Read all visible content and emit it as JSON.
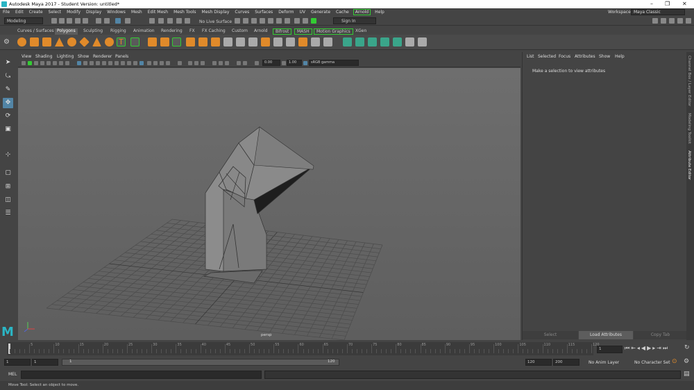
{
  "window": {
    "title": "Autodesk Maya 2017 - Student Version: untitled*",
    "minimize": "–",
    "maximize": "❐",
    "close": "✕"
  },
  "menu": [
    "File",
    "Edit",
    "Create",
    "Select",
    "Modify",
    "Display",
    "Windows",
    "Mesh",
    "Edit Mesh",
    "Mesh Tools",
    "Mesh Display",
    "Curves",
    "Surfaces",
    "Deform",
    "UV",
    "Generate",
    "Cache",
    "Arnold",
    "Help"
  ],
  "workspace": {
    "label": "Workspace :",
    "value": "Maya Classic"
  },
  "status": {
    "mode": "Modeling",
    "live_surface": "No Live Surface",
    "sign_in": "Sign In"
  },
  "shelf_tabs": [
    "Curves / Surfaces",
    "Polygons",
    "Sculpting",
    "Rigging",
    "Animation",
    "Rendering",
    "FX",
    "FX Caching",
    "Custom",
    "Arnold",
    "Bifrost",
    "MASH",
    "Motion Graphics",
    "XGen"
  ],
  "active_shelf": "Polygons",
  "viewport": {
    "menu": [
      "View",
      "Shading",
      "Lighting",
      "Show",
      "Renderer",
      "Panels"
    ],
    "exposure": "0.00",
    "gamma": "1.00",
    "color_space": "sRGB gamma",
    "camera_label": "persp"
  },
  "attribute_editor": {
    "menu": [
      "List",
      "Selected",
      "Focus",
      "Attributes",
      "Show",
      "Help"
    ],
    "message": "Make a selection to view attributes",
    "buttons": [
      "Select",
      "Load Attributes",
      "Copy Tab"
    ]
  },
  "side_tabs": [
    "Channel Box / Layer Editor",
    "Modeling Toolkit",
    "Attribute Editor"
  ],
  "timeline": {
    "ticks": [
      "5",
      "10",
      "15",
      "20",
      "25",
      "30",
      "35",
      "40",
      "45",
      "50",
      "55",
      "60",
      "65",
      "70",
      "75",
      "80",
      "85",
      "90",
      "95",
      "100",
      "105",
      "110",
      "115",
      "120"
    ],
    "current_frame": "1"
  },
  "range": {
    "start": "1",
    "start2": "1",
    "slider_start": "1",
    "slider_end": "120",
    "end": "120",
    "end2": "200",
    "anim_layer": "No Anim Layer",
    "char_set": "No Character Set"
  },
  "command": {
    "lang": "MEL"
  },
  "help": "Move Tool: Select an object to move.",
  "colors": {
    "accent": "#5285a6",
    "shelf_icon": "#e08a2a",
    "highlight": "#33cc33"
  }
}
